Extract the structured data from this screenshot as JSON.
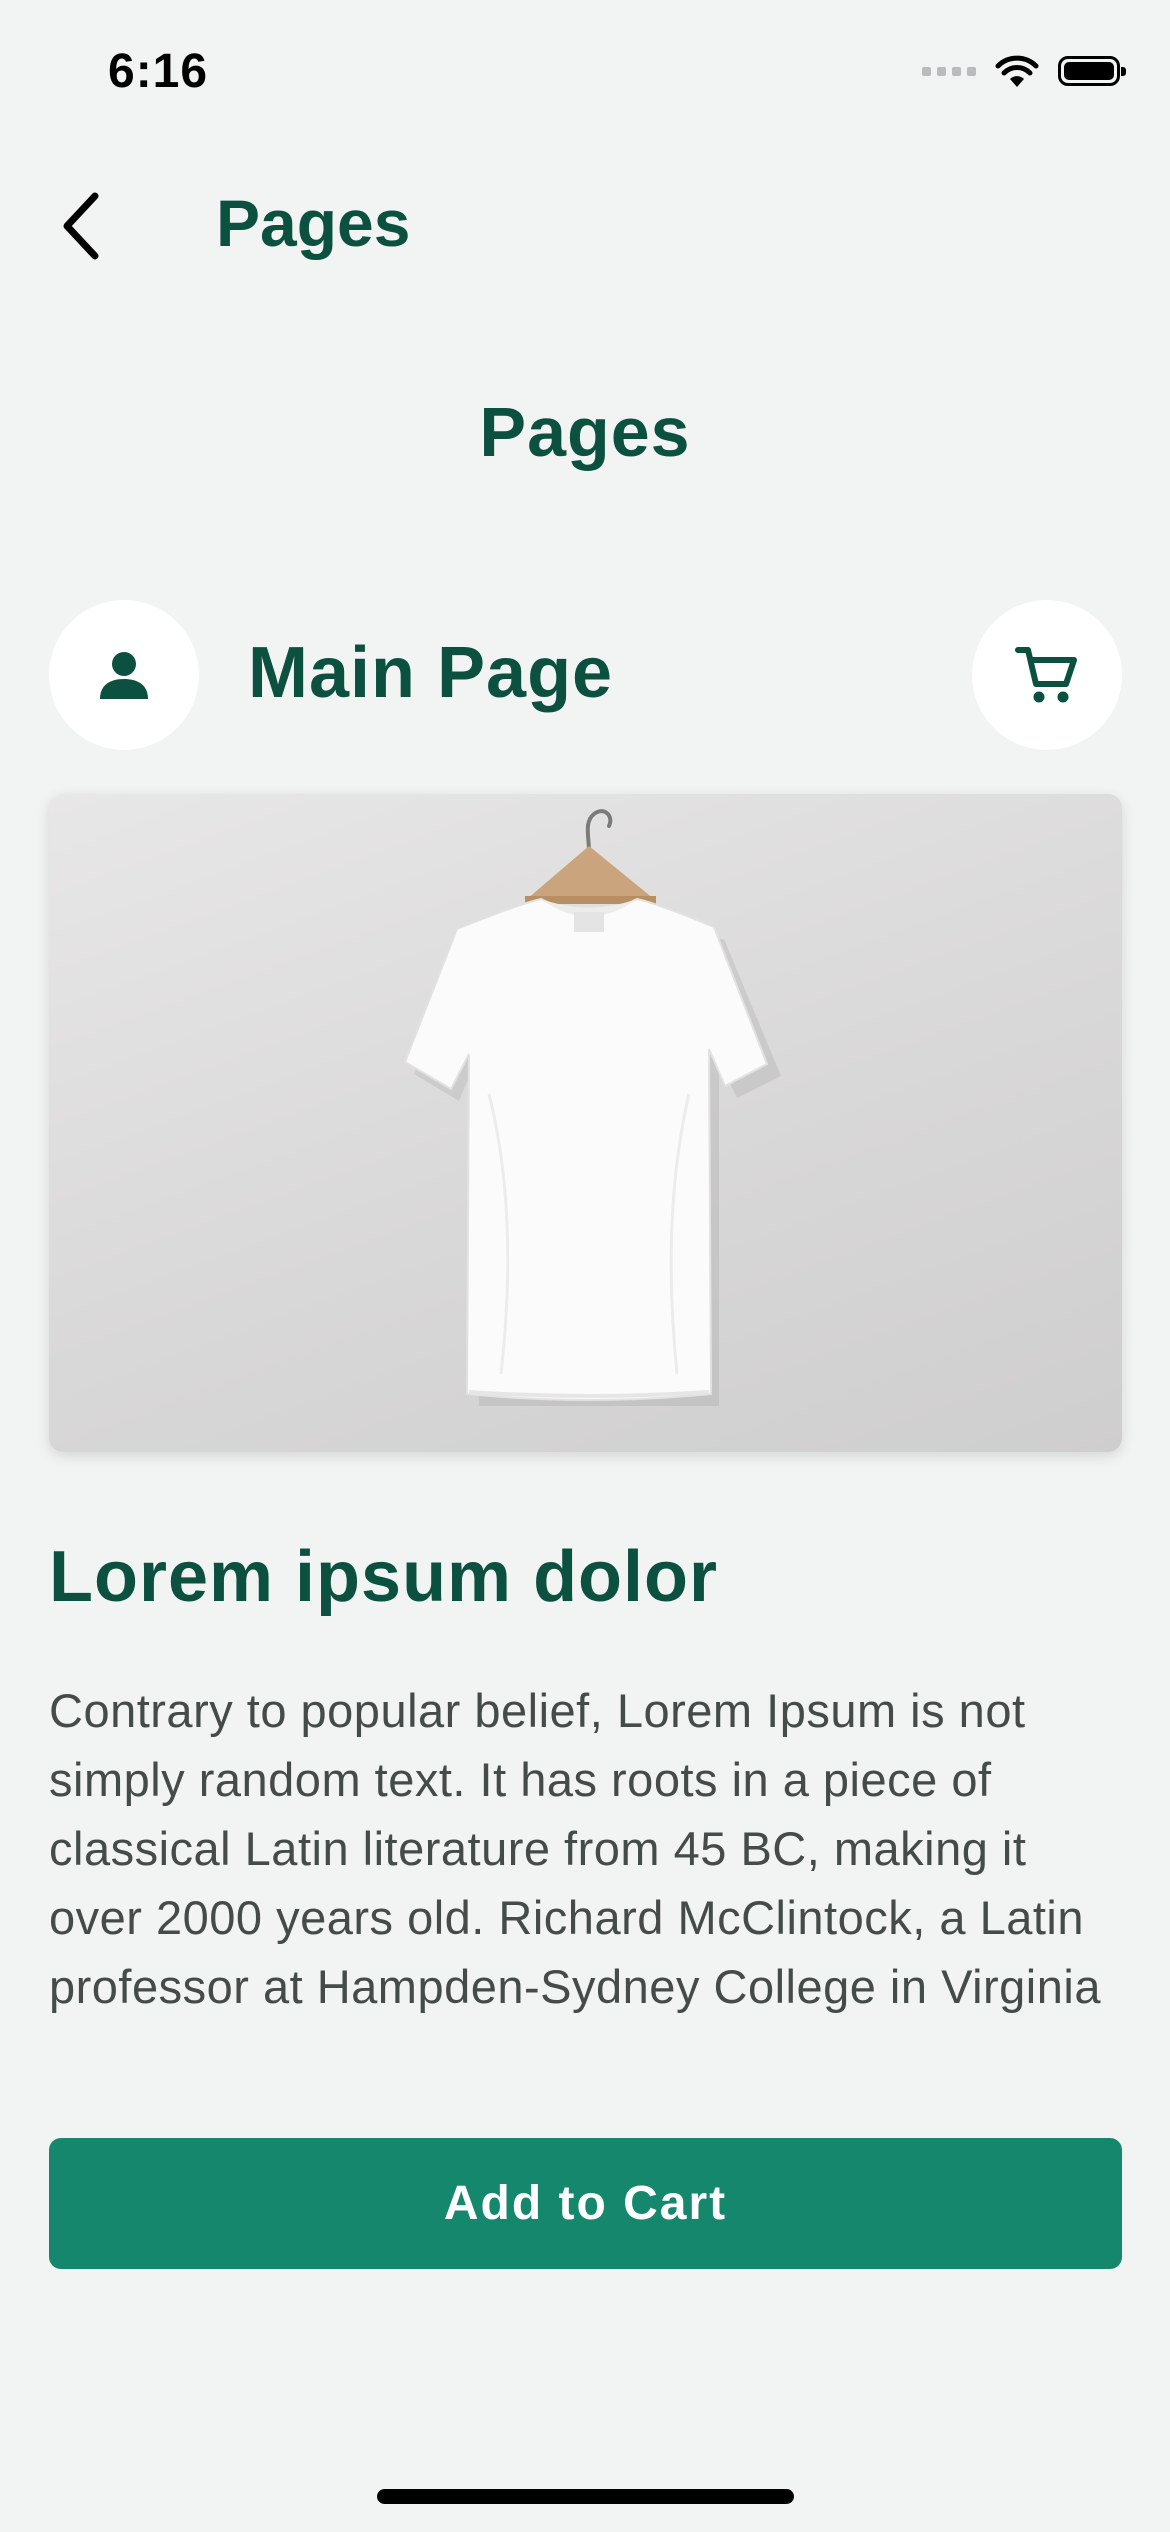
{
  "status_bar": {
    "time": "6:16",
    "icons": [
      "cellular-signal-icon",
      "wifi-icon",
      "battery-icon"
    ]
  },
  "nav": {
    "back_icon": "chevron-left-icon",
    "title": "Pages"
  },
  "page": {
    "heading": "Pages"
  },
  "header": {
    "profile_icon": "person-icon",
    "title": "Main Page",
    "cart_icon": "cart-icon"
  },
  "product": {
    "image_subject": "white t-shirt on wooden hanger",
    "title": "Lorem ipsum dolor",
    "description": "Contrary to popular belief, Lorem Ipsum is not simply random text. It has roots in a piece of classical Latin literature from 45 BC, making it over 2000 years old. Richard McClintock, a Latin professor at Hampden-Sydney College in Virginia",
    "add_to_cart_label": "Add to Cart"
  },
  "colors": {
    "background": "#f2f4f3",
    "primary_text": "#0c5140",
    "button": "#15876c",
    "body_text": "#444b49",
    "surface": "#ffffff"
  }
}
